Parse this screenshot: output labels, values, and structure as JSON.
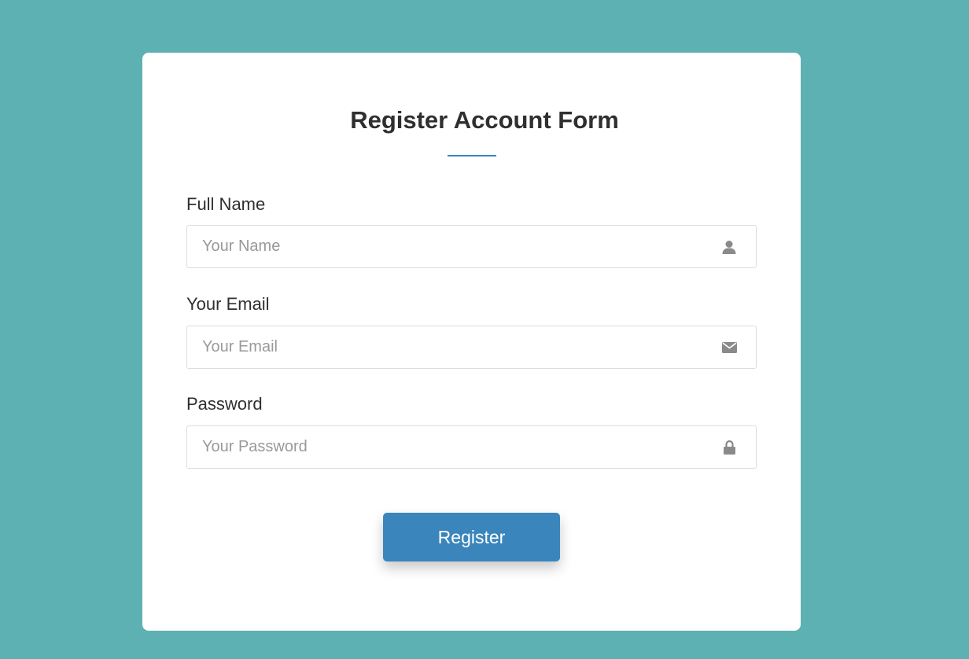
{
  "form": {
    "title": "Register Account Form",
    "fields": [
      {
        "label": "Full Name",
        "placeholder": "Your Name",
        "value": "",
        "icon": "user-icon"
      },
      {
        "label": "Your Email",
        "placeholder": "Your Email",
        "value": "",
        "icon": "envelope-icon"
      },
      {
        "label": "Password",
        "placeholder": "Your Password",
        "value": "",
        "icon": "lock-icon"
      }
    ],
    "submit_label": "Register"
  },
  "colors": {
    "page_background": "#5eb1b3",
    "card_background": "#ffffff",
    "accent": "#3a86bc",
    "text": "#2f2f2f",
    "placeholder": "#999999",
    "icon": "#8a8a8a"
  }
}
